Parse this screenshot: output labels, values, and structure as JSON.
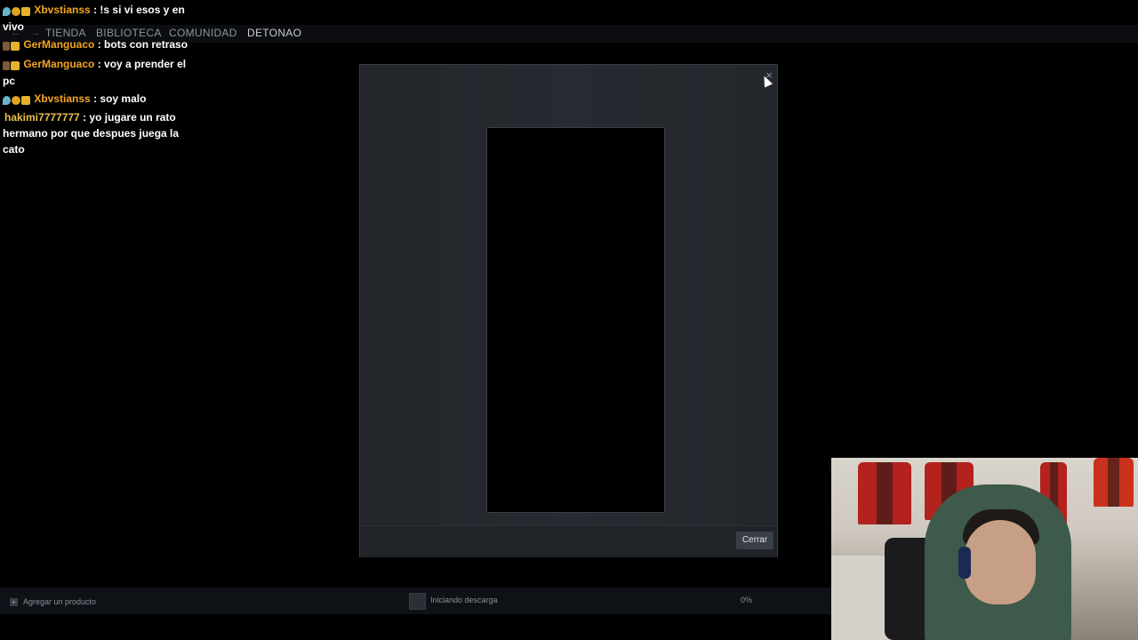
{
  "chat": {
    "messages": [
      {
        "user": "Xbvstianss",
        "text": ": !s si vi esos y en vivo"
      },
      {
        "user": "GerManguaco",
        "text": ": bots con retraso"
      },
      {
        "user": "GerManguaco",
        "text": ": voy a prender el pc"
      },
      {
        "user": "Xbvstianss",
        "text": ": soy malo"
      },
      {
        "user": "hakimi7777777",
        "text": ": yo jugare un rato hermano por que despues juega la cato"
      }
    ]
  },
  "nav": {
    "arrows": "← →",
    "items": [
      "TIENDA",
      "BIBLIOTECA",
      "COMUNIDAD",
      "DETONAO"
    ],
    "active_index": 3
  },
  "dialog": {
    "close_glyph": "×",
    "close_button": "Cerrar"
  },
  "bottom_bar": {
    "add_product": "Agregar un producto",
    "download_status": "Iniciando descarga",
    "download_percent": "0%",
    "download_progress": 0
  },
  "colors": {
    "username": "#f5a623",
    "dialog_bg": "#23262b",
    "nav_bg": "#0b0d11"
  }
}
